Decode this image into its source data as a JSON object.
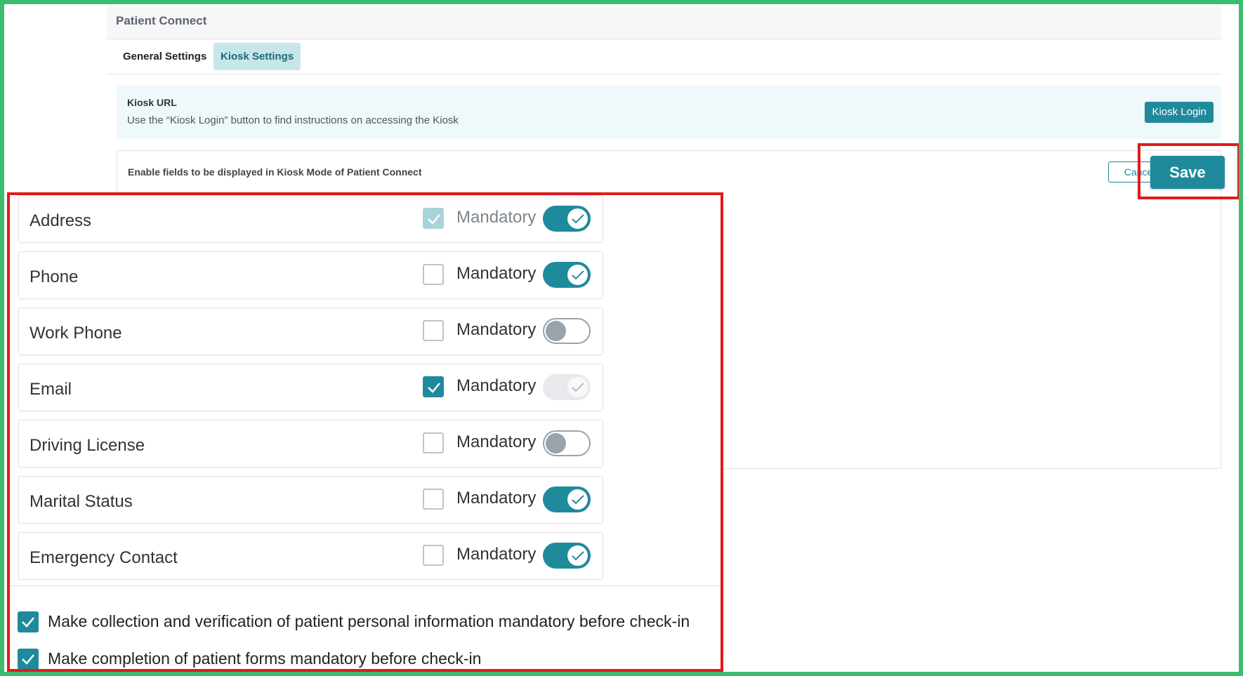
{
  "app": {
    "title": "Patient Connect"
  },
  "tabs": [
    {
      "label": "General Settings",
      "active": false
    },
    {
      "label": "Kiosk Settings",
      "active": true
    }
  ],
  "kiosk_url": {
    "title": "Kiosk URL",
    "description": "Use the “Kiosk Login” button to find instructions on accessing the Kiosk",
    "login_button": "Kiosk Login"
  },
  "fields_panel": {
    "title": "Enable fields to be displayed in Kiosk Mode of Patient Connect",
    "cancel_button": "Cancel",
    "save_button": "Save"
  },
  "fields": [
    {
      "label": "Address",
      "mandatory_label": "Mandatory",
      "mandatory": true,
      "mandatory_disabled": true,
      "enabled": true,
      "toggle_disabled": false
    },
    {
      "label": "Phone",
      "mandatory_label": "Mandatory",
      "mandatory": false,
      "mandatory_disabled": false,
      "enabled": true,
      "toggle_disabled": false
    },
    {
      "label": "Work Phone",
      "mandatory_label": "Mandatory",
      "mandatory": false,
      "mandatory_disabled": false,
      "enabled": false,
      "toggle_disabled": false
    },
    {
      "label": "Email",
      "mandatory_label": "Mandatory",
      "mandatory": true,
      "mandatory_disabled": false,
      "enabled": true,
      "toggle_disabled": true
    },
    {
      "label": "Driving License",
      "mandatory_label": "Mandatory",
      "mandatory": false,
      "mandatory_disabled": false,
      "enabled": false,
      "toggle_disabled": false
    },
    {
      "label": "Marital Status",
      "mandatory_label": "Mandatory",
      "mandatory": false,
      "mandatory_disabled": false,
      "enabled": true,
      "toggle_disabled": false
    },
    {
      "label": "Emergency Contact",
      "mandatory_label": "Mandatory",
      "mandatory": false,
      "mandatory_disabled": false,
      "enabled": true,
      "toggle_disabled": false
    }
  ],
  "options": [
    {
      "label": "Make collection and verification of patient personal information mandatory before check-in",
      "checked": true
    },
    {
      "label": "Make completion of patient forms mandatory before check-in",
      "checked": true
    }
  ],
  "colors": {
    "accent": "#1f8a9c",
    "highlight": "#e01b1b",
    "frame": "#3dbb6e"
  }
}
